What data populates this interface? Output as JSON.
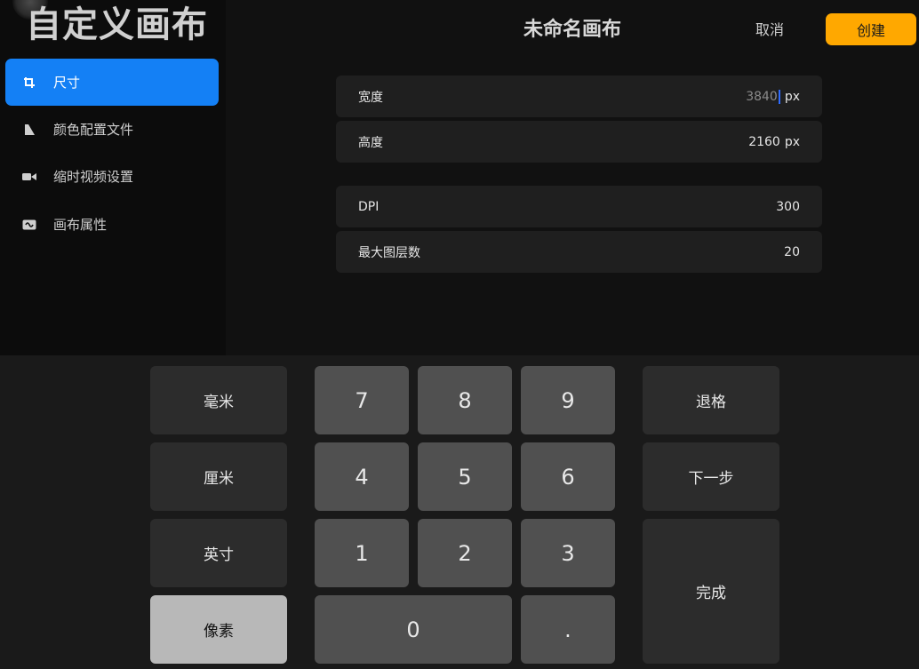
{
  "sidebar": {
    "title": "自定义画布",
    "items": [
      {
        "label": "尺寸",
        "icon": "crop-icon",
        "active": true
      },
      {
        "label": "颜色配置文件",
        "icon": "color-profile-icon",
        "active": false
      },
      {
        "label": "缩时视频设置",
        "icon": "video-camera-icon",
        "active": false
      },
      {
        "label": "画布属性",
        "icon": "canvas-properties-icon",
        "active": false
      }
    ]
  },
  "header": {
    "title": "未命名画布",
    "cancel_label": "取消",
    "create_label": "创建"
  },
  "fields": {
    "width": {
      "label": "宽度",
      "value": "3840",
      "unit": "px"
    },
    "height": {
      "label": "高度",
      "value": "2160",
      "unit": "px"
    },
    "dpi": {
      "label": "DPI",
      "value": "300"
    },
    "max_layers": {
      "label": "最大图层数",
      "value": "20"
    }
  },
  "keypad": {
    "units": [
      "毫米",
      "厘米",
      "英寸",
      "像素"
    ],
    "selected_unit": "像素",
    "digits": [
      "7",
      "8",
      "9",
      "4",
      "5",
      "6",
      "1",
      "2",
      "3",
      "0",
      "."
    ],
    "backspace_label": "退格",
    "next_label": "下一步",
    "done_label": "完成"
  },
  "colors": {
    "accent_blue": "#1480f5",
    "create_orange": "#ffa800",
    "background": "#111111",
    "field_bg": "#1f1f1f",
    "key_bg": "#505050",
    "selected_unit_bg": "#b8b8b8"
  }
}
